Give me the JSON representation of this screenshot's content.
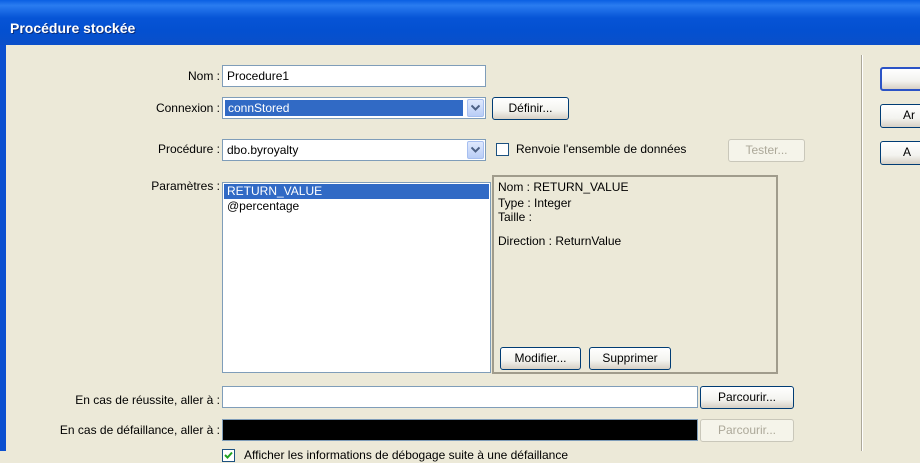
{
  "window": {
    "title": "Procédure stockée"
  },
  "form": {
    "nom_label": "Nom :",
    "nom_value": "Procedure1",
    "connexion_label": "Connexion :",
    "connexion_value": "connStored",
    "definir_button": "Définir...",
    "procedure_label": "Procédure :",
    "procedure_value": "dbo.byroyalty",
    "renvoie_label": "Renvoie l'ensemble de données",
    "renvoie_checked": false,
    "tester_button": "Tester...",
    "parametres_label": "Paramètres :",
    "parameters": [
      "RETURN_VALUE",
      "@percentage"
    ],
    "selected_parameter": "RETURN_VALUE",
    "details": {
      "nom": "Nom : RETURN_VALUE",
      "type": "Type : Integer",
      "taille": "Taille :",
      "direction": "Direction : ReturnValue"
    },
    "modifier_button": "Modifier...",
    "supprimer_button": "Supprimer",
    "reussite_label": "En cas de réussite, aller à :",
    "reussite_value": "",
    "parcourir_button": "Parcourir...",
    "defaillance_label": "En cas de défaillance, aller à :",
    "defaillance_value": "",
    "parcourir2_button": "Parcourir...",
    "debug_label": "Afficher les informations de débogage suite à une défaillance",
    "debug_checked": true
  },
  "side_buttons": [
    "",
    "Ar",
    "A"
  ],
  "colors": {
    "title_bar": "#0a5fe3",
    "selection": "#316ac5",
    "dialog_bg": "#ece9d8",
    "check_mark": "#21a121"
  }
}
